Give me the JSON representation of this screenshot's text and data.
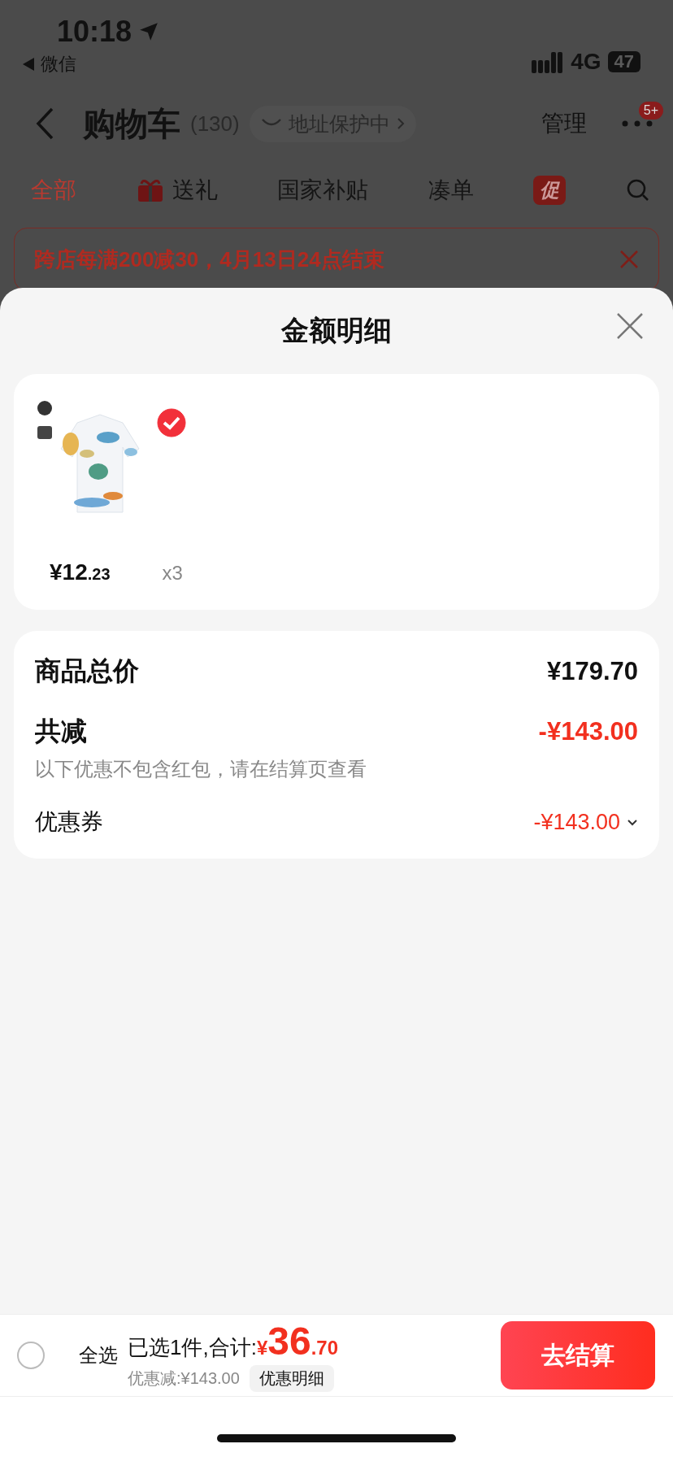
{
  "status_bar": {
    "time": "10:18",
    "back_app": "微信",
    "network": "4G",
    "battery": "47"
  },
  "nav": {
    "title": "购物车",
    "count": "(130)",
    "address_chip": "地址保护中",
    "manage": "管理",
    "more_badge": "5+"
  },
  "tabs": [
    {
      "label": "全部",
      "selected": true,
      "kind": "text"
    },
    {
      "label": "送礼",
      "selected": false,
      "kind": "gift"
    },
    {
      "label": "国家补贴",
      "selected": false,
      "kind": "text"
    },
    {
      "label": "凑单",
      "selected": false,
      "kind": "text"
    },
    {
      "label": "促",
      "selected": false,
      "kind": "badge"
    }
  ],
  "promo_banner": {
    "text": "跨店每满200减30，4月13日24点结束"
  },
  "sheet": {
    "title": "金额明细",
    "product": {
      "kind": "picture",
      "selected": true,
      "price_integer": "¥12",
      "price_decimal": ".23",
      "quantity": "x3"
    },
    "summary": [
      {
        "kind": "total",
        "label": "商品总价",
        "amount": "¥179.70"
      },
      {
        "kind": "discount",
        "label": "共减",
        "amount": "-¥143.00",
        "note": "以下优惠不包含红包，请在结算页查看"
      },
      {
        "kind": "coupon",
        "label": "优惠券",
        "amount": "-¥143.00",
        "expanded": false
      }
    ]
  },
  "checkout_bar": {
    "select_all": {
      "label": "全选",
      "checked": false
    },
    "selected_text": "已选1件,合计:",
    "currency": "¥",
    "total_integer": "36",
    "total_decimal": ".70",
    "discount_text": "优惠减:¥143.00",
    "detail_chip": "优惠明细",
    "checkout_button": "去结算"
  }
}
